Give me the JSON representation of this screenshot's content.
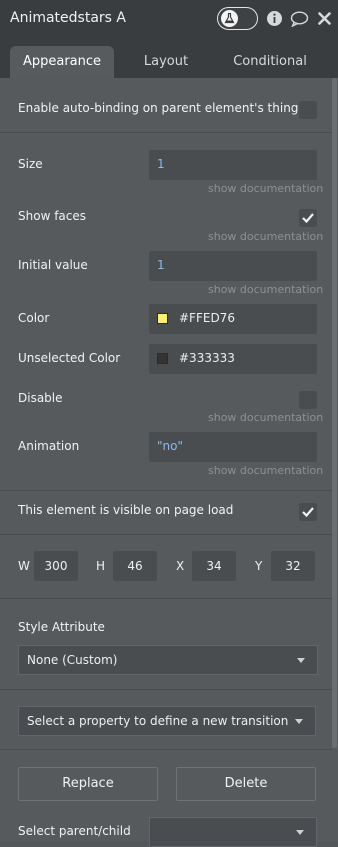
{
  "element_name": "Animatedstars A",
  "tabs": [
    {
      "label": "Appearance",
      "active": true
    },
    {
      "label": "Layout",
      "active": false
    },
    {
      "label": "Conditional",
      "active": false
    }
  ],
  "auto_binding": {
    "label": "Enable auto-binding on parent element's thing",
    "checked": false
  },
  "fields": {
    "size": {
      "label": "Size",
      "value": "1",
      "doc": "show documentation"
    },
    "show_faces": {
      "label": "Show faces",
      "checked": true,
      "doc": "show documentation"
    },
    "initial_value": {
      "label": "Initial value",
      "value": "1",
      "doc": "show documentation"
    },
    "color": {
      "label": "Color",
      "value": "#FFED76",
      "swatch": "#FFED76"
    },
    "unselected_color": {
      "label": "Unselected Color",
      "value": "#333333",
      "swatch": "#333333"
    },
    "disable": {
      "label": "Disable",
      "checked": false,
      "doc": "show documentation"
    },
    "animation": {
      "label": "Animation",
      "value": "\"no\"",
      "doc": "show documentation"
    }
  },
  "visible_on_load": {
    "label": "This element is visible on page load",
    "checked": true
  },
  "dimensions": {
    "w_label": "W",
    "w": "300",
    "h_label": "H",
    "h": "46",
    "x_label": "X",
    "x": "34",
    "y_label": "Y",
    "y": "32"
  },
  "style": {
    "label": "Style Attribute",
    "value": "None (Custom)"
  },
  "transition": {
    "placeholder": "Select a property to define a new transition"
  },
  "buttons": {
    "replace": "Replace",
    "delete": "Delete"
  },
  "parent_child": {
    "label": "Select parent/child",
    "value": ""
  },
  "icons": {
    "toggle": "flask-icon",
    "info": "info-icon",
    "comment": "comment-icon",
    "close": "close-icon",
    "check": "checkmark-icon",
    "caret": "chevron-down-icon"
  }
}
